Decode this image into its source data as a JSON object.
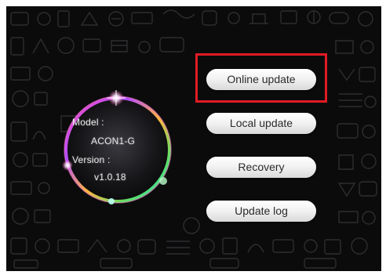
{
  "device": {
    "model_label": "Model :",
    "model_value": "ACON1-G",
    "version_label": "Version :",
    "version_value": "v1.0.18"
  },
  "menu": {
    "online_update": "Online update",
    "local_update": "Local update",
    "recovery": "Recovery",
    "update_log": "Update log"
  },
  "highlight": {
    "target": "Online update",
    "color": "#e11b24"
  },
  "colors": {
    "background": "#0b0b0c",
    "button": "#f1f1f1",
    "button_text": "#2a2a2a"
  }
}
